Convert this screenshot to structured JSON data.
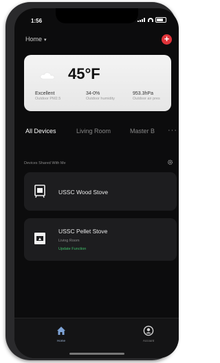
{
  "status_bar": {
    "time": "1:56"
  },
  "header": {
    "home_label": "Home",
    "chevron": "▾",
    "add_symbol": "+"
  },
  "weather": {
    "temperature": "45°F",
    "icon": "cloud-icon",
    "stats": [
      {
        "value": "Excellent",
        "label": "Outdoor PM2.5"
      },
      {
        "value": "34-0%",
        "label": "Outdoor humidity"
      },
      {
        "value": "953.3hPa",
        "label": "Outdoor air pres"
      }
    ]
  },
  "tabs": [
    {
      "label": "All Devices",
      "active": true
    },
    {
      "label": "Living Room",
      "active": false
    },
    {
      "label": "Master B",
      "active": false
    }
  ],
  "tabs_more": "···",
  "section": {
    "title": "Devices Shared With Me"
  },
  "devices": [
    {
      "name": "USSC Wood Stove",
      "icon": "wood-stove-icon"
    },
    {
      "name": "USSC Pellet Stove",
      "room": "Living Room",
      "update": "Update Function",
      "icon": "pellet-stove-icon"
    }
  ],
  "bottom_nav": [
    {
      "label": "Home",
      "icon": "home-icon",
      "active": true
    },
    {
      "label": "Account",
      "icon": "account-icon",
      "active": false
    }
  ],
  "colors": {
    "accent_red": "#e0343a",
    "update_green": "#3fbf6a",
    "nav_active": "#9fb6d8"
  }
}
